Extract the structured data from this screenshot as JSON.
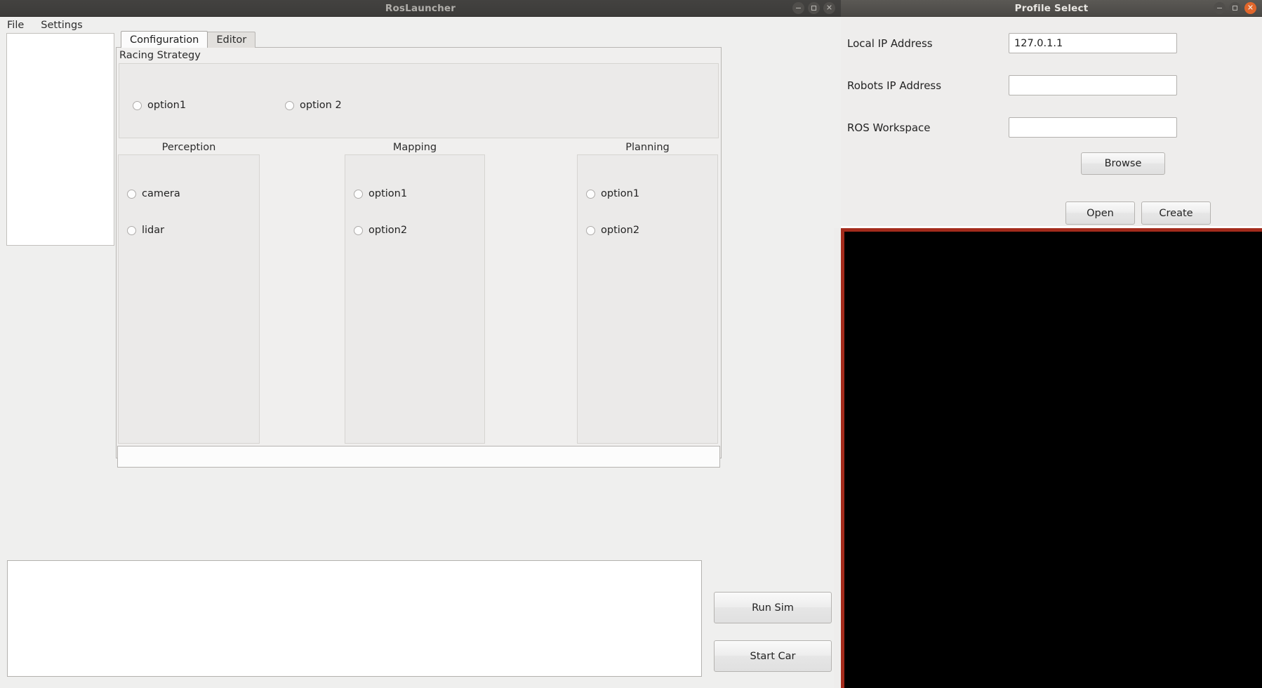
{
  "main_window": {
    "title": "RosLauncher",
    "window_controls": [
      {
        "name": "minimize",
        "glyph": "minimize-icon"
      },
      {
        "name": "maximize",
        "glyph": "maximize-icon"
      },
      {
        "name": "close",
        "glyph": "close-icon"
      }
    ],
    "menubar": {
      "items": [
        "File",
        "Settings"
      ]
    },
    "tabs": [
      {
        "label": "Configuration",
        "active": true
      },
      {
        "label": "Editor",
        "active": false
      }
    ],
    "racing_strategy": {
      "group_label": "Racing Strategy",
      "options": [
        {
          "label": "option1",
          "selected": false
        },
        {
          "label": "option 2",
          "selected": false
        }
      ]
    },
    "columns": [
      {
        "title": "Perception",
        "options": [
          {
            "label": "camera",
            "selected": false
          },
          {
            "label": "lidar",
            "selected": false
          }
        ]
      },
      {
        "title": "Mapping",
        "options": [
          {
            "label": "option1",
            "selected": false
          },
          {
            "label": "option2",
            "selected": false
          }
        ]
      },
      {
        "title": "Planning",
        "options": [
          {
            "label": "option1",
            "selected": false
          },
          {
            "label": "option2",
            "selected": false
          }
        ]
      }
    ],
    "log_area": {
      "value": "",
      "placeholder": ""
    },
    "actions": {
      "run_sim_label": "Run Sim",
      "start_car_label": "Start Car"
    }
  },
  "profile_dialog": {
    "title": "Profile Select",
    "window_controls": [
      {
        "name": "minimize",
        "glyph": "minimize-icon"
      },
      {
        "name": "maximize",
        "glyph": "maximize-icon"
      },
      {
        "name": "close",
        "glyph": "close-icon"
      }
    ],
    "fields": [
      {
        "label": "Local IP Address",
        "value": "127.0.1.1",
        "placeholder": ""
      },
      {
        "label": "Robots IP Address",
        "value": "",
        "placeholder": ""
      },
      {
        "label": "ROS Workspace",
        "value": "",
        "placeholder": ""
      }
    ],
    "buttons": {
      "browse_label": "Browse",
      "open_label": "Open",
      "create_label": "Create"
    }
  },
  "terminal": {
    "content": "",
    "border_color": "#a32b1c",
    "background_color": "#000000"
  }
}
